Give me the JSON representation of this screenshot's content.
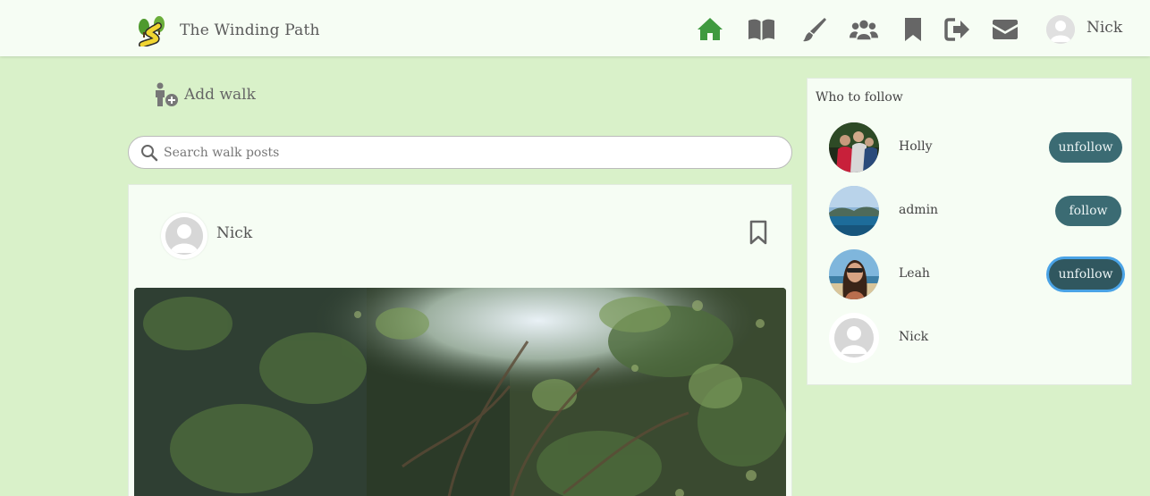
{
  "app": {
    "name": "The Winding Path"
  },
  "nav": {
    "icons": [
      "home-icon",
      "book-icon",
      "brush-icon",
      "users-icon",
      "bookmark-icon",
      "sign-out-icon",
      "envelope-icon"
    ],
    "active_color": "#3f9a3f",
    "icon_color": "#666666",
    "user_name": "Nick"
  },
  "actions": {
    "add_walk_label": "Add walk"
  },
  "search": {
    "placeholder": "Search walk posts",
    "value": ""
  },
  "post": {
    "author": "Nick"
  },
  "who_to_follow": {
    "title": "Who to follow",
    "users": [
      {
        "name": "Holly",
        "button": "unfollow"
      },
      {
        "name": "admin",
        "button": "follow"
      },
      {
        "name": "Leah",
        "button": "unfollow"
      },
      {
        "name": "Nick",
        "button": ""
      }
    ]
  },
  "colors": {
    "page_bg": "#d9f1c9",
    "card_bg": "#f6fdf4",
    "button_bg": "#3b6b73"
  }
}
